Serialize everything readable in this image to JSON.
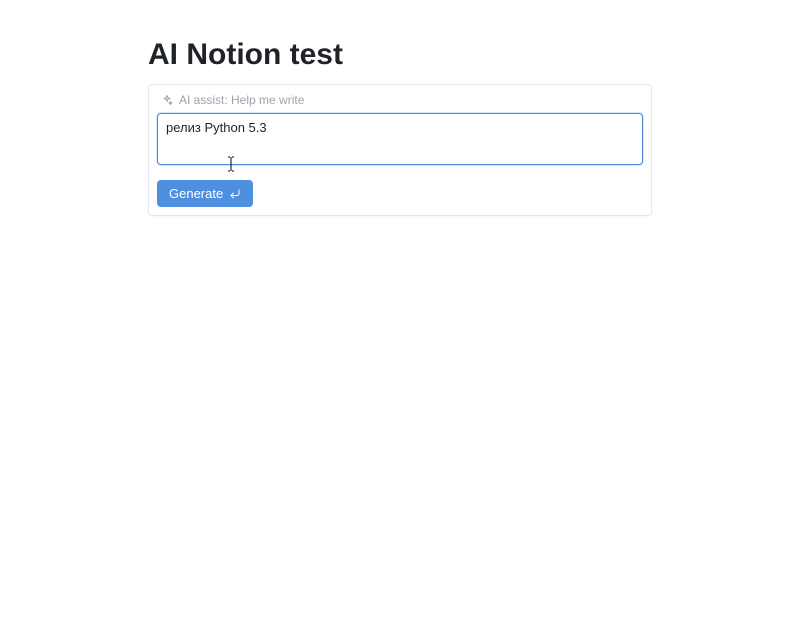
{
  "page": {
    "title": "AI Notion test"
  },
  "assist": {
    "label": "AI assist: Help me write"
  },
  "input": {
    "value": "релиз Python 5.3",
    "placeholder": ""
  },
  "actions": {
    "generate_label": "Generate"
  },
  "icons": {
    "sparkle": "sparkle-icon",
    "enter": "enter-icon"
  }
}
